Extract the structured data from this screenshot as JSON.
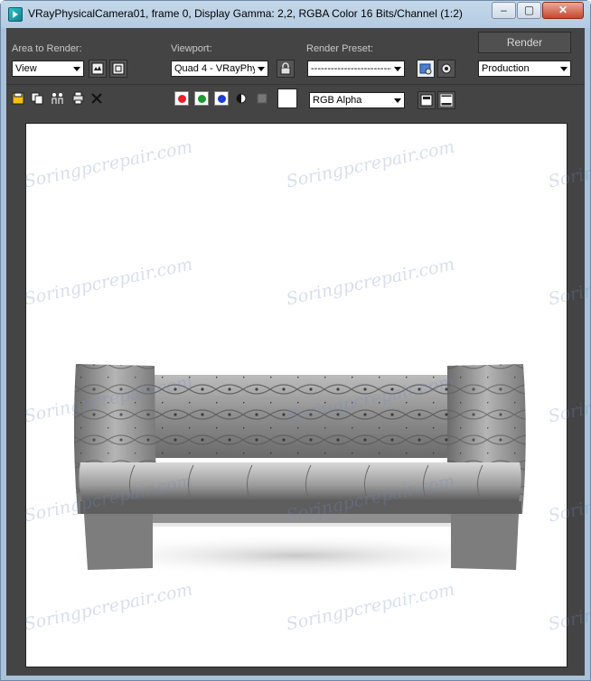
{
  "window": {
    "title": "VRayPhysicalCamera01, frame 0, Display Gamma: 2,2, RGBA Color 16 Bits/Channel (1:2)"
  },
  "titlebar_buttons": {
    "minimize": "–",
    "maximize": "▢",
    "close": "✕"
  },
  "area_to_render": {
    "label": "Area to Render:",
    "value": "View"
  },
  "viewport": {
    "label": "Viewport:",
    "value": "Quad 4 - VRayPhy"
  },
  "render_preset": {
    "label": "Render Preset:",
    "value": "-------------------------"
  },
  "render_button": {
    "label": "Render"
  },
  "production": {
    "value": "Production"
  },
  "channel": {
    "value": "RGB Alpha"
  },
  "colors": {
    "red": "#e8202a",
    "green": "#1a9a2e",
    "blue": "#1c3fd0",
    "panel": "#444444"
  },
  "watermark": {
    "text": "Soringpcrepair.com"
  }
}
